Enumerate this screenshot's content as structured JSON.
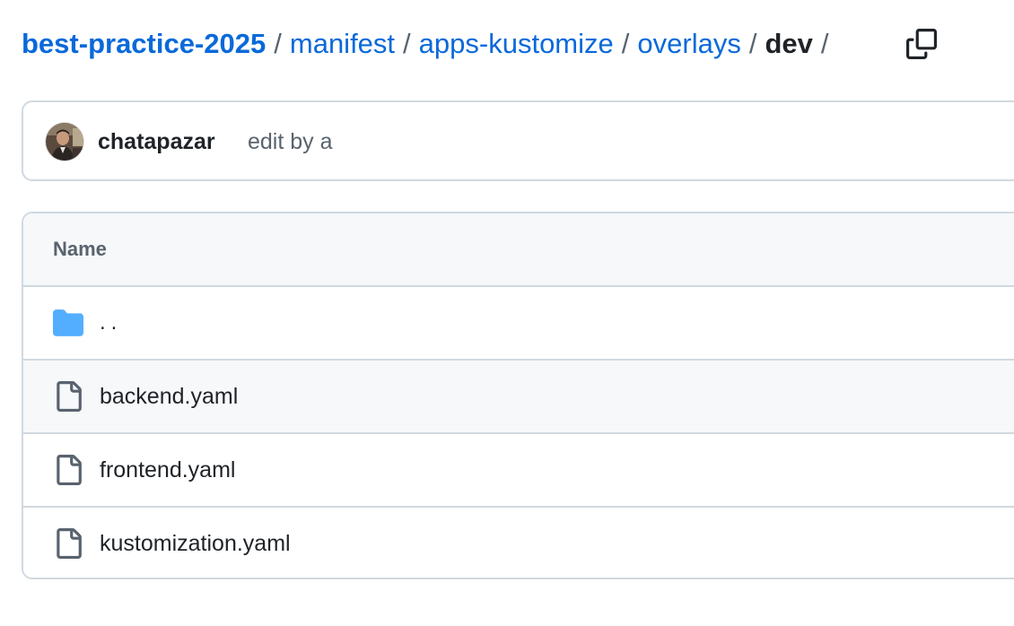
{
  "breadcrumb": {
    "repo": "best-practice-2025",
    "segments": [
      "manifest",
      "apps-kustomize",
      "overlays"
    ],
    "current": "dev",
    "separator": "/",
    "copy_icon": "copy-icon"
  },
  "commit": {
    "author": "chatapazar",
    "message": "edit by a"
  },
  "table": {
    "header": "Name",
    "rows": [
      {
        "name": "..",
        "icon": "folder-icon"
      },
      {
        "name": "backend.yaml",
        "icon": "file-icon"
      },
      {
        "name": "frontend.yaml",
        "icon": "file-icon"
      },
      {
        "name": "kustomization.yaml",
        "icon": "file-icon"
      }
    ]
  },
  "colors": {
    "link": "#0969da",
    "text": "#1f2328",
    "muted": "#59636e",
    "border": "#d1d9e0",
    "header_bg": "#f6f8fa",
    "folder": "#54aeff"
  }
}
